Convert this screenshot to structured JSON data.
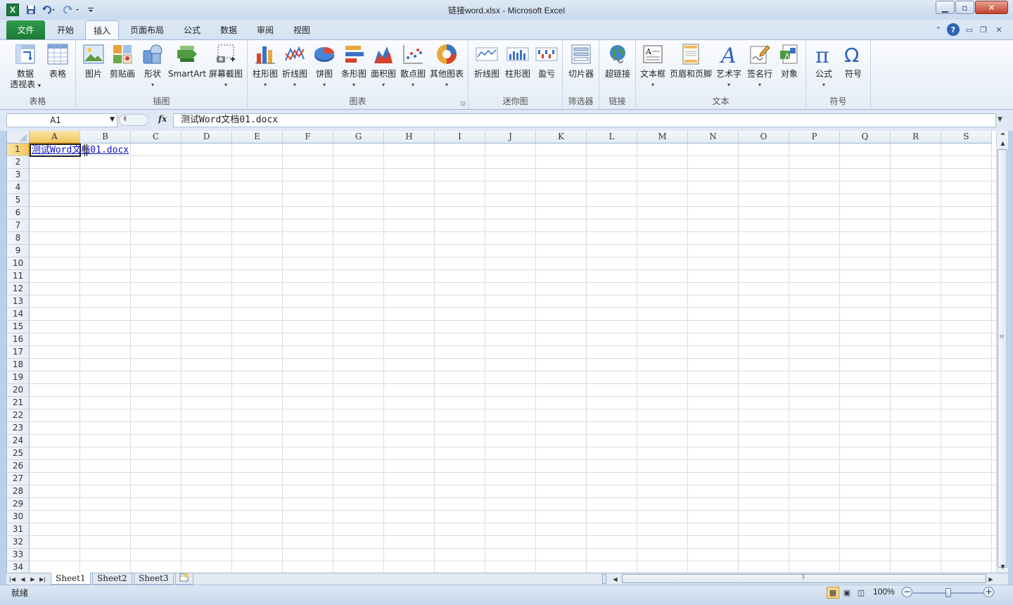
{
  "window": {
    "title": "链接word.xlsx - Microsoft Excel",
    "app_icon_letter": "X",
    "controls": [
      "minimize",
      "maximize",
      "close"
    ]
  },
  "quick_access": [
    "save-icon",
    "undo-icon",
    "redo-icon",
    "customize-icon"
  ],
  "tabs": [
    {
      "label": "文件",
      "active": false
    },
    {
      "label": "开始",
      "active": false
    },
    {
      "label": "插入",
      "active": true
    },
    {
      "label": "页面布局",
      "active": false
    },
    {
      "label": "公式",
      "active": false
    },
    {
      "label": "数据",
      "active": false
    },
    {
      "label": "审阅",
      "active": false
    },
    {
      "label": "视图",
      "active": false
    }
  ],
  "ribbon": {
    "groups": {
      "tables": {
        "label": "表格",
        "buttons": [
          {
            "label1": "数据",
            "label2": "透视表",
            "icon": "pivot-table-icon"
          },
          {
            "label1": "表格",
            "icon": "table-icon"
          }
        ]
      },
      "illustrations": {
        "label": "插图",
        "buttons": [
          {
            "label1": "图片",
            "icon": "picture-icon"
          },
          {
            "label1": "剪贴画",
            "icon": "clipart-icon"
          },
          {
            "label1": "形状",
            "icon": "shapes-icon"
          },
          {
            "label1": "SmartArt",
            "icon": "smartart-icon"
          },
          {
            "label1": "屏幕截图",
            "icon": "screenshot-icon"
          }
        ]
      },
      "charts": {
        "label": "图表",
        "buttons": [
          {
            "label1": "柱形图",
            "icon": "column-chart-icon"
          },
          {
            "label1": "折线图",
            "icon": "line-chart-icon"
          },
          {
            "label1": "饼图",
            "icon": "pie-chart-icon"
          },
          {
            "label1": "条形图",
            "icon": "bar-chart-icon"
          },
          {
            "label1": "面积图",
            "icon": "area-chart-icon"
          },
          {
            "label1": "散点图",
            "icon": "scatter-chart-icon"
          },
          {
            "label1": "其他图表",
            "icon": "other-charts-icon"
          }
        ]
      },
      "sparklines": {
        "label": "迷你图",
        "buttons": [
          {
            "label1": "折线图",
            "icon": "sparkline-line-icon"
          },
          {
            "label1": "柱形图",
            "icon": "sparkline-column-icon"
          },
          {
            "label1": "盈亏",
            "icon": "sparkline-winloss-icon"
          }
        ]
      },
      "filter": {
        "label": "筛选器",
        "buttons": [
          {
            "label1": "切片器",
            "icon": "slicer-icon"
          }
        ]
      },
      "links": {
        "label": "链接",
        "buttons": [
          {
            "label1": "超链接",
            "icon": "hyperlink-icon"
          }
        ]
      },
      "text": {
        "label": "文本",
        "buttons": [
          {
            "label1": "文本框",
            "icon": "textbox-icon"
          },
          {
            "label1": "页眉和页脚",
            "icon": "header-footer-icon"
          },
          {
            "label1": "艺术字",
            "icon": "wordart-icon"
          },
          {
            "label1": "签名行",
            "icon": "signature-line-icon"
          },
          {
            "label1": "对象",
            "icon": "object-icon"
          }
        ]
      },
      "symbols": {
        "label": "符号",
        "buttons": [
          {
            "label1": "公式",
            "icon": "equation-icon"
          },
          {
            "label1": "符号",
            "icon": "symbol-icon"
          }
        ]
      }
    }
  },
  "formula_bar": {
    "name_box": "A1",
    "fx_label": "fx",
    "content": "测试Word文档01.docx"
  },
  "grid": {
    "columns": [
      "A",
      "B",
      "C",
      "D",
      "E",
      "F",
      "G",
      "H",
      "I",
      "J",
      "K",
      "L",
      "M",
      "N",
      "O",
      "P",
      "Q",
      "R",
      "S"
    ],
    "rows": [
      "1",
      "2",
      "3",
      "4",
      "5",
      "6",
      "7",
      "8",
      "9",
      "10",
      "11",
      "12",
      "13",
      "14",
      "15",
      "16",
      "17",
      "18",
      "19",
      "20",
      "21",
      "22",
      "23",
      "24",
      "25",
      "26",
      "27",
      "28",
      "29",
      "30",
      "31",
      "32",
      "33",
      "34"
    ],
    "selected_cell": "A1",
    "cells": {
      "A1": "测试Word文档01.docx"
    }
  },
  "sheets": {
    "tabs": [
      "Sheet1",
      "Sheet2",
      "Sheet3"
    ],
    "active": "Sheet1"
  },
  "status": {
    "text": "就绪",
    "zoom": "100%",
    "zoom_level_percent": 100
  },
  "colors": {
    "hyperlink": "#1010c8",
    "file_tab": "#1c7a35",
    "selection_header": "#f1c766"
  }
}
